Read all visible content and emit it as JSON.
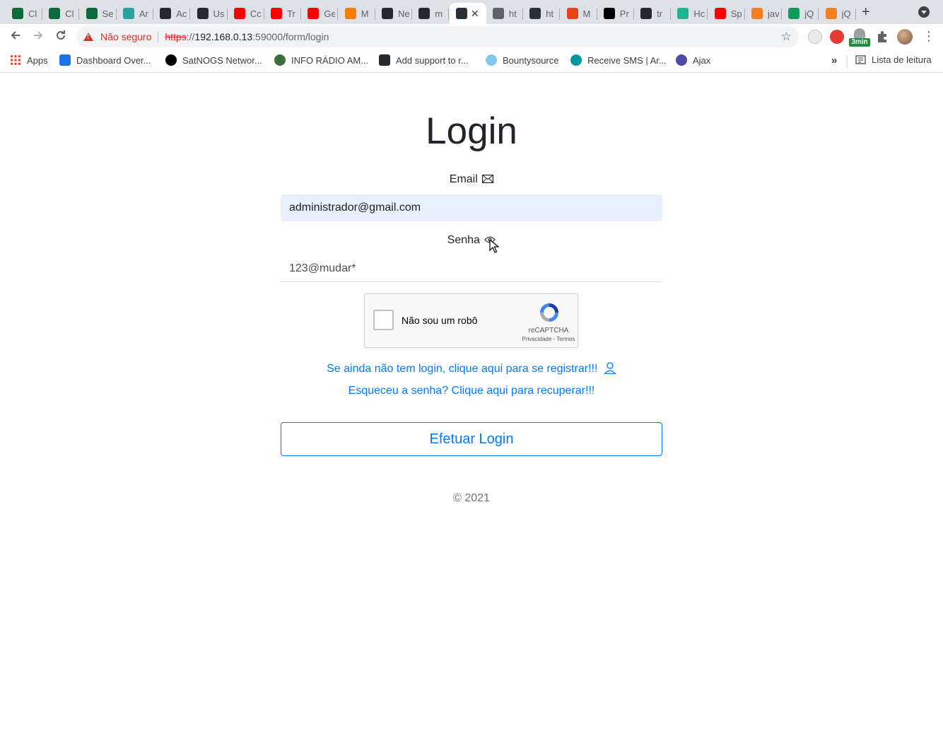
{
  "browser": {
    "tabs": [
      {
        "label": "Cl",
        "color": "#0b6b3a"
      },
      {
        "label": "Cl",
        "color": "#0b6b3a"
      },
      {
        "label": "Se",
        "color": "#0b6b3a"
      },
      {
        "label": "Ar",
        "color": "#2aa0a0"
      },
      {
        "label": "Ac",
        "color": "#24292e"
      },
      {
        "label": "Us",
        "color": "#24292e"
      },
      {
        "label": "Cc",
        "color": "#ff0000"
      },
      {
        "label": "Tr",
        "color": "#ff0000"
      },
      {
        "label": "Ge",
        "color": "#ff0000"
      },
      {
        "label": "M",
        "color": "#f57d00"
      },
      {
        "label": "Ne",
        "color": "#24292e"
      },
      {
        "label": "m",
        "color": "#24292e"
      },
      {
        "label": "",
        "color": "#263238",
        "active": true
      },
      {
        "label": "ht",
        "color": "#5f6368"
      },
      {
        "label": "ht",
        "color": "#263238"
      },
      {
        "label": "M",
        "color": "#e8411e"
      },
      {
        "label": "Pr",
        "color": "#000000"
      },
      {
        "label": "tr",
        "color": "#24292e"
      },
      {
        "label": "Hc",
        "color": "#1fb38f"
      },
      {
        "label": "Sp",
        "color": "#ff0000"
      },
      {
        "label": "jav",
        "color": "#f48024"
      },
      {
        "label": "jQ",
        "color": "#0f9d58"
      },
      {
        "label": "jQ",
        "color": "#f48024"
      }
    ],
    "address": {
      "security_label": "Não seguro",
      "scheme": "https",
      "host": "192.168.0.13",
      "rest": ":59000/form/login"
    },
    "extension_badge": "3min",
    "bookmarks": [
      {
        "label": "Apps",
        "color": "#ea4335"
      },
      {
        "label": "Dashboard Over...",
        "color": "#1a73e8"
      },
      {
        "label": "SatNOGS Networ...",
        "color": "#000000"
      },
      {
        "label": "INFO RÁDIO AM...",
        "color": "#3c6e3c"
      },
      {
        "label": "Add support to r...",
        "color": "#24292e"
      },
      {
        "label": "Bountysource",
        "color": "#7fc8e8"
      },
      {
        "label": "Receive SMS | Ar...",
        "color": "#00979d"
      },
      {
        "label": "Ajax",
        "color": "#4b4ba8"
      }
    ],
    "reading_list": "Lista de leitura",
    "more": "»"
  },
  "form": {
    "title": "Login",
    "email_label": "Email",
    "email_value": "administrador@gmail.com",
    "password_label": "Senha",
    "password_value": "123@mudar*",
    "captcha": {
      "label": "Não sou um robô",
      "brand": "reCAPTCHA",
      "links": "Privacidade - Termos"
    },
    "register_link": "Se ainda não tem login, clique aqui para se registrar!!!",
    "recover_link": "Esqueceu a senha? Clique aqui para recuperar!!!",
    "submit": "Efetuar Login",
    "footer": "© 2021"
  }
}
